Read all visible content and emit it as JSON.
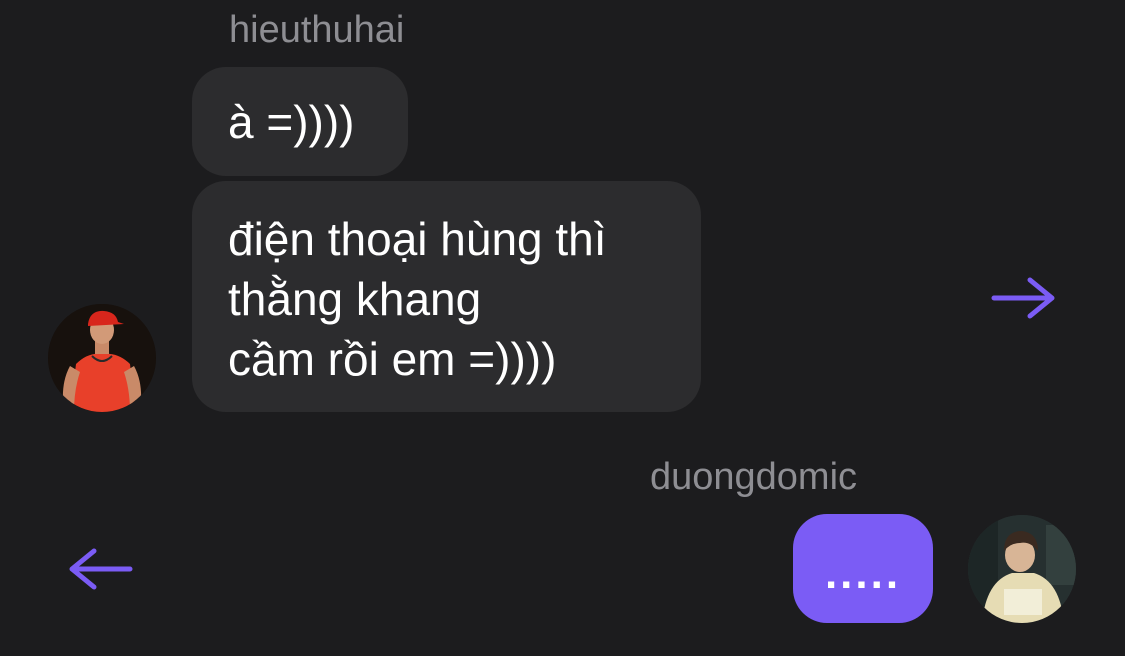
{
  "thread": {
    "incoming": {
      "sender": "hieuthuhai",
      "messages": [
        {
          "lines": [
            "à =))))"
          ]
        },
        {
          "lines": [
            "điện thoại hùng thì",
            "thằng khang",
            "cầm rồi em =))))"
          ]
        }
      ]
    },
    "outgoing": {
      "sender": "duongdomic",
      "messages": [
        {
          "lines": [
            "....."
          ]
        }
      ]
    }
  },
  "icons": {
    "forward": "arrow-right-icon",
    "back": "arrow-left-icon"
  },
  "colors": {
    "background": "#1c1c1e",
    "incoming_bubble": "#2c2c2e",
    "outgoing_bubble": "#7b5cf5",
    "accent": "#7b5cf5",
    "sender_name": "#8e8e93"
  }
}
